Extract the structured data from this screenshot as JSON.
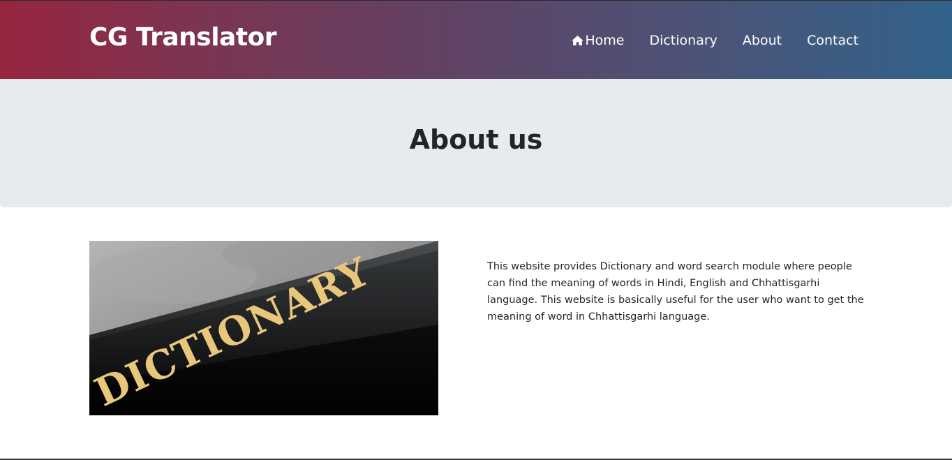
{
  "header": {
    "brand": "CG Translator",
    "nav": [
      {
        "label": "Home",
        "icon": "home-icon"
      },
      {
        "label": "Dictionary"
      },
      {
        "label": "About"
      },
      {
        "label": "Contact"
      }
    ]
  },
  "hero": {
    "title": "About us"
  },
  "content": {
    "image_text": "DICTIONARY",
    "description": "This website provides Dictionary and word search module where people can find the meaning of words in Hindi, English and Chhattisgarhi language. This website is basically useful for the user who want to get the meaning of word in Chhattisgarhi language."
  },
  "colors": {
    "gradient_start": "#97253f",
    "gradient_end": "#32628a",
    "jumbotron_bg": "#e8ebee",
    "gold_text": "#e9c77a"
  }
}
